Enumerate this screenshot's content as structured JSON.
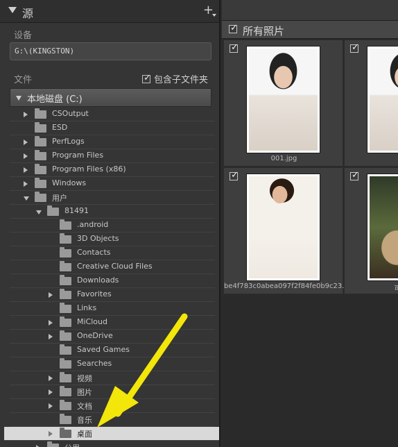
{
  "source_panel": {
    "title": "源",
    "add_label": "+",
    "device_label": "设备",
    "device_value": "G:\\(KINGSTON)",
    "folders_label": "文件",
    "include_subfolders_label": "包含子文件夹",
    "drive_label": "本地磁盘 (C:)"
  },
  "tree": [
    {
      "label": "CSOutput",
      "depth": 0,
      "arrow": "right"
    },
    {
      "label": "ESD",
      "depth": 0,
      "arrow": "none"
    },
    {
      "label": "PerfLogs",
      "depth": 0,
      "arrow": "right"
    },
    {
      "label": "Program Files",
      "depth": 0,
      "arrow": "right"
    },
    {
      "label": "Program Files (x86)",
      "depth": 0,
      "arrow": "right"
    },
    {
      "label": "Windows",
      "depth": 0,
      "arrow": "right"
    },
    {
      "label": "用户",
      "depth": 0,
      "arrow": "down"
    },
    {
      "label": "81491",
      "depth": 1,
      "arrow": "down"
    },
    {
      "label": ".android",
      "depth": 2,
      "arrow": "none"
    },
    {
      "label": "3D Objects",
      "depth": 2,
      "arrow": "none"
    },
    {
      "label": "Contacts",
      "depth": 2,
      "arrow": "none"
    },
    {
      "label": "Creative Cloud Files",
      "depth": 2,
      "arrow": "none"
    },
    {
      "label": "Downloads",
      "depth": 2,
      "arrow": "none"
    },
    {
      "label": "Favorites",
      "depth": 2,
      "arrow": "right"
    },
    {
      "label": "Links",
      "depth": 2,
      "arrow": "none"
    },
    {
      "label": "MiCloud",
      "depth": 2,
      "arrow": "right"
    },
    {
      "label": "OneDrive",
      "depth": 2,
      "arrow": "right"
    },
    {
      "label": "Saved Games",
      "depth": 2,
      "arrow": "none"
    },
    {
      "label": "Searches",
      "depth": 2,
      "arrow": "none"
    },
    {
      "label": "视频",
      "depth": 2,
      "arrow": "right"
    },
    {
      "label": "图片",
      "depth": 2,
      "arrow": "right"
    },
    {
      "label": "文档",
      "depth": 2,
      "arrow": "right"
    },
    {
      "label": "音乐",
      "depth": 2,
      "arrow": "none"
    },
    {
      "label": "桌面",
      "depth": 2,
      "arrow": "hollow",
      "selected": true
    },
    {
      "label": "公用",
      "depth": 1,
      "arrow": "right"
    }
  ],
  "grid": {
    "all_photos_label": "所有照片",
    "items": [
      {
        "filename": "001.jpg",
        "checked": true,
        "photo": "p1"
      },
      {
        "filename": "",
        "checked": true,
        "photo": "p1"
      },
      {
        "filename": "be4f783c0abea097f2f84fe0b9c23...",
        "checked": true,
        "photo": "p3"
      },
      {
        "filename": "可爱小",
        "checked": true,
        "photo": "p4"
      }
    ]
  },
  "colors": {
    "panel_bg": "#353535",
    "grid_bg": "#2a2a2a",
    "selected_row": "#d9d9d9",
    "annotation_arrow": "#f2e60a"
  }
}
